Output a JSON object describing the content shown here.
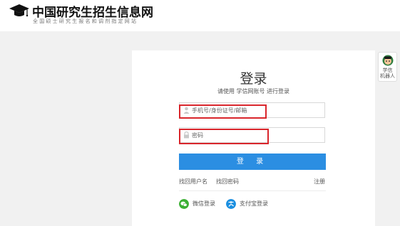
{
  "site": {
    "title": "中国研究生招生信息网",
    "subtitle": "全国硕士研究生报名和调剂指定网站",
    "logo_icon": "graduation-cap-icon"
  },
  "login": {
    "title": "登录",
    "subtitle": "请使用 学信网账号 进行登录",
    "username_placeholder": "手机号/身份证号/邮箱",
    "password_placeholder": "密码",
    "login_button": "登 录",
    "find_username": "找回用户名",
    "find_password": "找回密码",
    "register": "注册",
    "wechat_login": "微信登录",
    "alipay_login": "支付宝登录"
  },
  "robot": {
    "label_line1": "学信",
    "label_line2": "机器人"
  },
  "colors": {
    "accent": "#2b8ee2",
    "highlight": "#d9252b",
    "wechat": "#3cb034",
    "alipay": "#1b8fe0"
  }
}
